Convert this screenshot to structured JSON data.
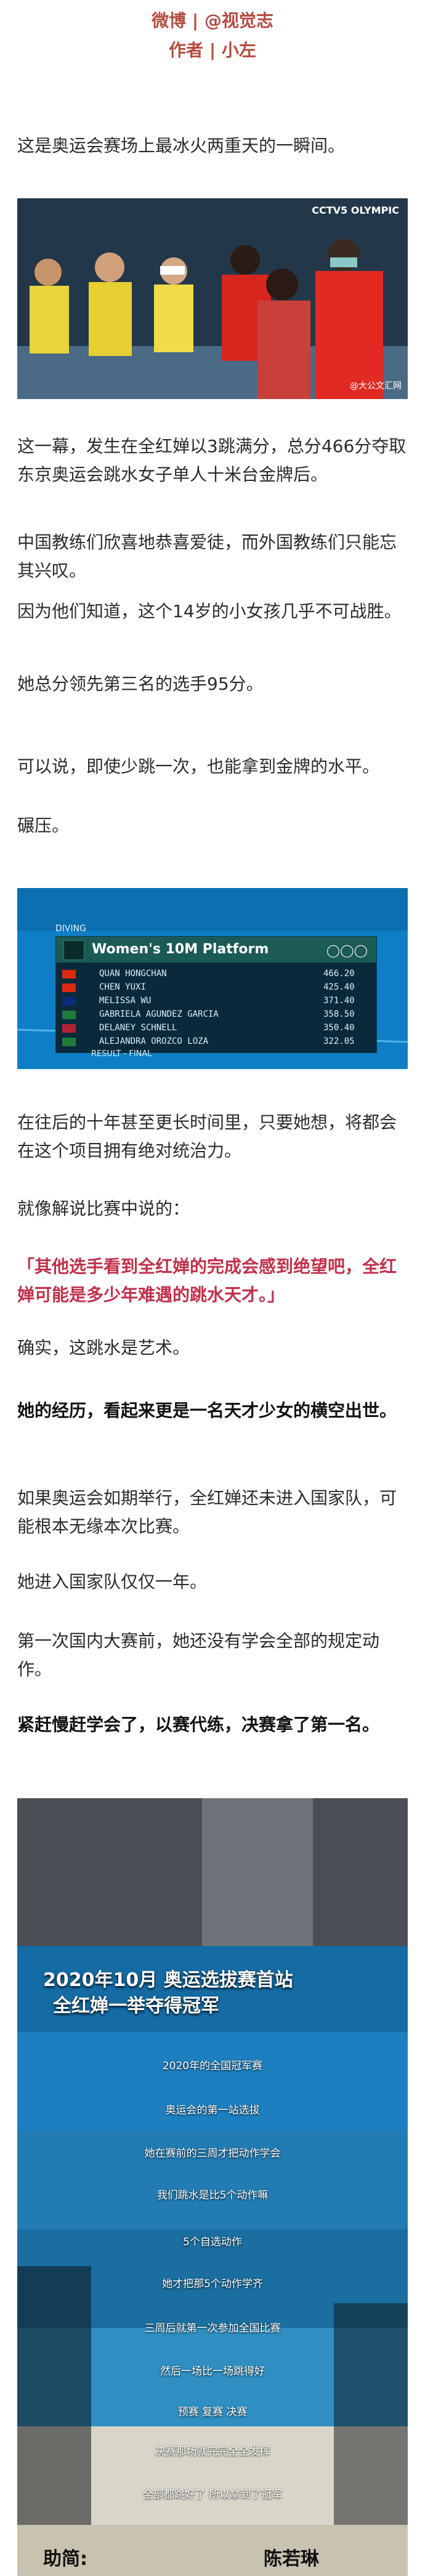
{
  "header": {
    "credit_line": "微博 | @视觉志",
    "author_line": "作者 | 小左"
  },
  "article": {
    "p1": "这是奥运会赛场上最冰火两重天的一瞬间。",
    "p2": "这一幕，发生在全红婵以3跳满分，总分466分夺取东京奥运会跳水女子单人十米台金牌后。",
    "p3": "中国教练们欣喜地恭喜爱徒，而外国教练们只能忘其兴叹。",
    "p4": "因为他们知道，这个14岁的小女孩几乎不可战胜。",
    "p5": "她总分领先第三名的选手95分。",
    "p6": "可以说，即使少跳一次，也能拿到金牌的水平。",
    "p7": "碾压。",
    "p8": "在往后的十年甚至更长时间里，只要她想，将都会在这个项目拥有绝对统治力。",
    "p9": "就像解说比赛中说的：",
    "quote": "「其他选手看到全红婵的完成会感到绝望吧，全红婵可能是多少年难遇的跳水天才。」",
    "p10": "确实，这跳水是艺术。",
    "bold1": "她的经历，看起来更是一名天才少女的横空出世。",
    "p11": "如果奥运会如期举行，全红婵还未进入国家队，可能根本无缘本次比赛。",
    "p12": "她进入国家队仅仅一年。",
    "p13": "第一次国内大赛前，她还没有学会全部的规定动作。",
    "bold2": "紧赶慢赶学会了，以赛代练，决赛拿了第一名。"
  },
  "image1": {
    "watermark": "CCTV5 OLYMPIC",
    "source": "@大公文汇网"
  },
  "scoreboard": {
    "event_label": "DIVING",
    "title": "Women's 10M Platform",
    "result_label": "RESULT - FINAL",
    "rows": [
      {
        "name": "QUAN HONGCHAN",
        "score": "466.20",
        "flag": "#de2910"
      },
      {
        "name": "CHEN YUXI",
        "score": "425.40",
        "flag": "#de2910"
      },
      {
        "name": "MELISSA WU",
        "score": "371.40",
        "flag": "#0b2a7a"
      },
      {
        "name": "GABRIELA AGUNDEZ GARCIA",
        "score": "358.50",
        "flag": "#1e7b3a"
      },
      {
        "name": "DELANEY SCHNELL",
        "score": "350.40",
        "flag": "#b22234"
      },
      {
        "name": "ALEJANDRA OROZCO LOZA",
        "score": "322.05",
        "flag": "#1e7b3a"
      }
    ]
  },
  "image3": {
    "headline1": "2020年10月 奥运选拔赛首站",
    "headline2": "全红婵一举夺得冠军",
    "captions": [
      "2020年的全国冠军赛",
      "奥运会的第一站选拔",
      "她在赛前的三周才把动作学会",
      "我们跳水是比5个动作嘛",
      "5个自选动作",
      "她才把那5个动作学齐",
      "三周后就第一次参加全国比赛",
      "然后一场比一场跳得好",
      "预赛 复赛 决赛",
      "决赛那场就完完全全发挥",
      "全部都跳好了 所以拿到了冠军"
    ],
    "bottom_left": "助简:",
    "bottom_right": "陈若琳"
  }
}
